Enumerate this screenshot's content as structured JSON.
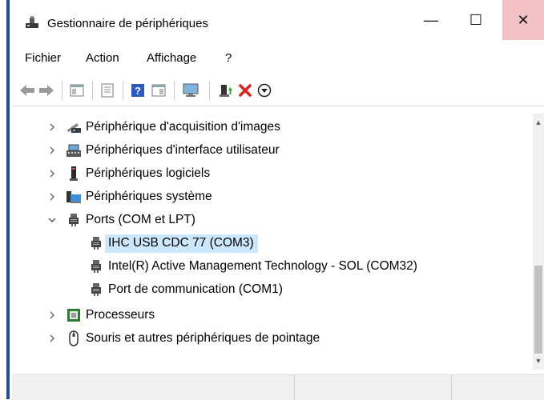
{
  "window": {
    "title": "Gestionnaire de périphériques",
    "controls": {
      "minimize": "—",
      "maximize": "☐",
      "close": "✕"
    }
  },
  "menu": [
    "Fichier",
    "Action",
    "Affichage",
    "?"
  ],
  "toolbar": [
    "back-icon",
    "forward-icon",
    "properties-icon",
    "show-hide-icon",
    "help-icon",
    "driver-icon",
    "scan-icon",
    "update-driver-icon",
    "uninstall-icon",
    "disable-icon"
  ],
  "tree": {
    "items": [
      {
        "label": "Périphérique d'acquisition d'images",
        "icon": "camera-scanner-icon",
        "expanded": false
      },
      {
        "label": "Périphériques d'interface utilisateur",
        "icon": "hid-icon",
        "expanded": false
      },
      {
        "label": "Périphériques logiciels",
        "icon": "software-device-icon",
        "expanded": false
      },
      {
        "label": "Périphériques système",
        "icon": "system-device-icon",
        "expanded": false
      },
      {
        "label": "Ports (COM et LPT)",
        "icon": "port-icon",
        "expanded": true,
        "children": [
          {
            "label": "IHC USB CDC 77 (COM3)",
            "icon": "port-icon",
            "selected": true
          },
          {
            "label": "Intel(R) Active Management Technology - SOL (COM32)",
            "icon": "port-icon"
          },
          {
            "label": "Port de communication (COM1)",
            "icon": "port-icon"
          }
        ]
      },
      {
        "label": "Processeurs",
        "icon": "processor-icon",
        "expanded": false
      },
      {
        "label": "Souris et autres périphériques de pointage",
        "icon": "mouse-icon",
        "expanded": false
      }
    ]
  },
  "colors": {
    "selection": "#cce8ff",
    "close_hover": "#f3c2c6",
    "accent": "#1f4f8f"
  }
}
